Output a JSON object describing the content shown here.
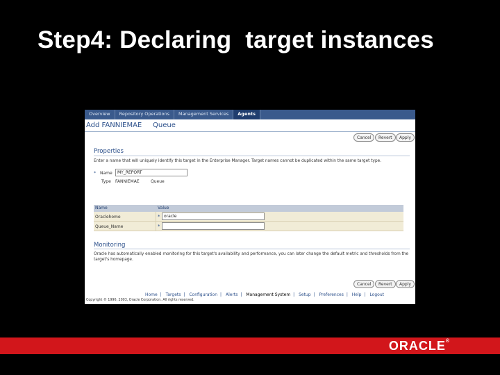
{
  "slide": {
    "title": "Step4: Declaring  target instances"
  },
  "tabs": [
    {
      "label": "Overview"
    },
    {
      "label": "Repository Operations"
    },
    {
      "label": "Management Services"
    },
    {
      "label": "Agents"
    }
  ],
  "header": {
    "title": "Add FANNIEMAE",
    "target_type": "Queue"
  },
  "buttons": {
    "cancel": "Cancel",
    "revert": "Revert",
    "apply": "Apply"
  },
  "properties": {
    "title": "Properties",
    "description": "Enter a name that will uniquely identify this target in the Enterprise Manager. Target names cannot be duplicated within the same target type.",
    "required_marker": "*",
    "name_label": "Name",
    "name_value": "MY_REPORT",
    "type_label": "Type",
    "type_value": "FANNIEMAE",
    "type_value2": "Queue"
  },
  "param_table": {
    "columns": [
      "Name",
      "Value"
    ],
    "rows": [
      {
        "name": "Oraclehome",
        "value": "oracle"
      },
      {
        "name": "Queue_Name",
        "value": ""
      }
    ]
  },
  "monitoring": {
    "title": "Monitoring",
    "description": "Oracle has automatically enabled monitoring for this target's availability and performance, you can later change the default metric and thresholds from the target's homepage."
  },
  "footer": {
    "links": [
      "Home",
      "Targets",
      "Configuration",
      "Alerts",
      "Management System",
      "Setup",
      "Preferences",
      "Help",
      "Logout"
    ],
    "separator": "|",
    "copyright": "Copyright © 1996, 2003, Oracle Corporation. All rights reserved."
  },
  "brand": {
    "logo": "ORACLE",
    "reg_mark": "®",
    "band_color": "#d2161b"
  }
}
